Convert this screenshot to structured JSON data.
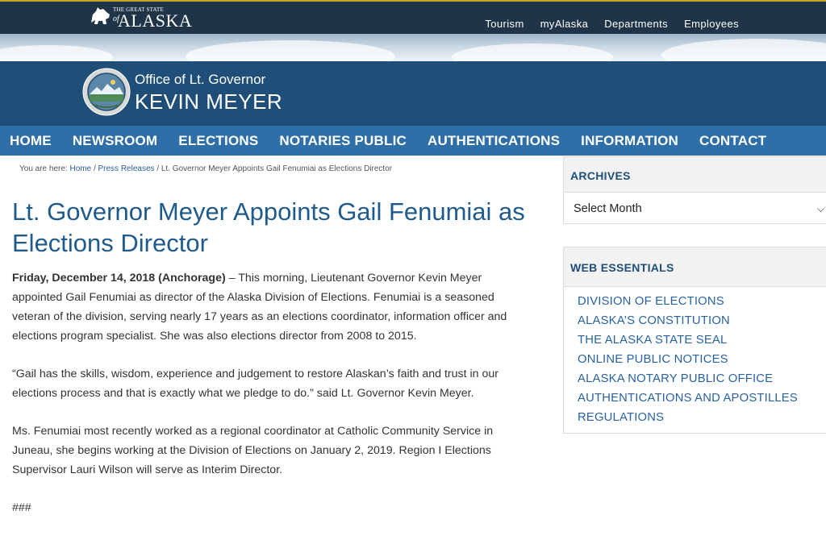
{
  "brand": {
    "state_small": "THE GREAT STATE",
    "state_of": "of",
    "state_big": "ALASKA"
  },
  "top_links": [
    "Tourism",
    "myAlaska",
    "Departments",
    "Employees"
  ],
  "office": {
    "line1": "Office of Lt. Governor",
    "line2": "KEVIN MEYER"
  },
  "nav": [
    "HOME",
    "NEWSROOM",
    "ELECTIONS",
    "NOTARIES PUBLIC",
    "AUTHENTICATIONS",
    "INFORMATION",
    "CONTACT"
  ],
  "breadcrumb": {
    "prefix": "You are here:",
    "home": "Home",
    "sep1": "/",
    "press": "Press Releases",
    "sep2": "/",
    "current": "Lt. Governor Meyer Appoints Gail Fenumiai as Elections Director"
  },
  "article": {
    "title": "Lt. Governor Meyer Appoints Gail Fenumiai as Elections Director",
    "dateline": "Friday, December 14, 2018 (Anchorage)",
    "p1_rest": " – This morning, Lieutenant Governor Kevin Meyer appointed Gail Fenumiai as director of the Alaska Division of Elections. Fenumiai is a seasoned veteran of the division, serving nearly 17 years as an elections coordinator, information officer and elections program specialist. She was also elections director from 2008 to 2015.",
    "p2": "“Gail has the skills, wisdom, experience and judgement to restore Alaskan’s faith and trust in our elections process and that is exactly what we pledge to do.” said Lt. Governor Kevin Meyer.",
    "p3": "Ms. Fenumiai most recently worked as a regional coordinator at Catholic Community Service in Juneau, she begins working at the Division of Elections on January 2, 2019. Region I Elections Supervisor Lauri Wilson will serve as Interim Director.",
    "p4": "###"
  },
  "sidebar": {
    "archives_title": "ARCHIVES",
    "archives_select": "Select Month",
    "essentials_title": "WEB ESSENTIALS",
    "essentials": [
      "DIVISION OF ELECTIONS",
      "ALASKA’S CONSTITUTION",
      "THE ALASKA STATE SEAL",
      "ONLINE PUBLIC NOTICES",
      "ALASKA NOTARY PUBLIC OFFICE",
      "AUTHENTICATIONS AND APOSTILLES",
      "REGULATIONS"
    ]
  },
  "colors": {
    "topbar": "#1f3447",
    "office_band": "#1f4e79",
    "nav_band": "#2f6fa7",
    "title_text": "#1f5a8c",
    "link": "#2a62a0"
  }
}
